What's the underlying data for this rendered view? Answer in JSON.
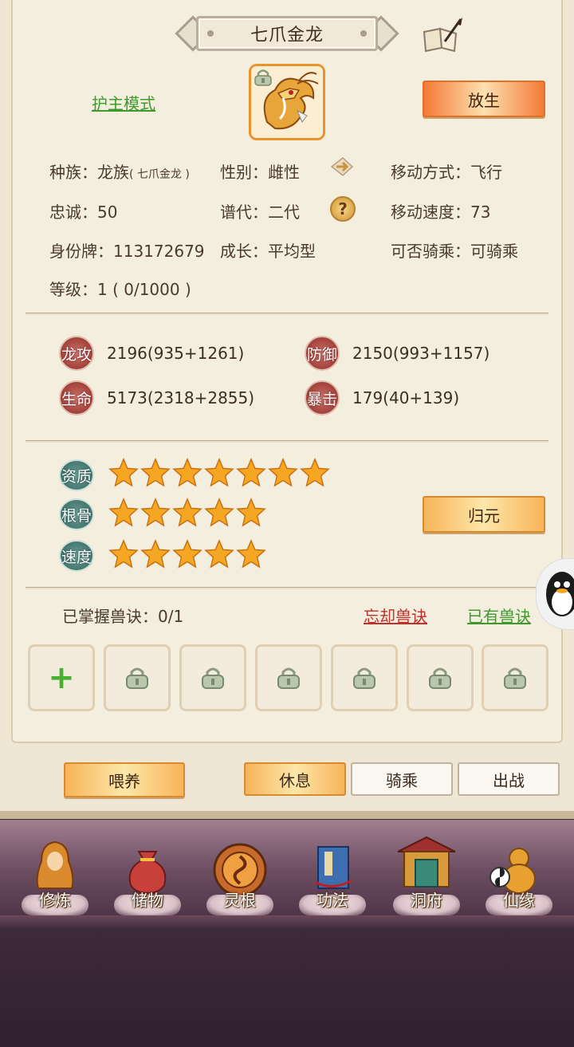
{
  "title": "七爪金龙",
  "top": {
    "guard_mode_link": "护主模式",
    "release_button": "放生"
  },
  "info": {
    "race_label": "种族：",
    "race_value": "龙族",
    "race_sub": "( 七爪金龙 )",
    "gender_label": "性别：",
    "gender_value": "雌性",
    "move_label": "移动方式：",
    "move_value": "飞行",
    "loyalty_label": "忠诚：",
    "loyalty_value": "50",
    "generation_label": "谱代：",
    "generation_value": "二代",
    "speed_label": "移动速度：",
    "speed_value": "73",
    "id_label": "身份牌：",
    "id_value": "113172679",
    "growth_label": "成长：",
    "growth_value": "平均型",
    "ride_label": "可否骑乘：",
    "ride_value": "可骑乘",
    "level_label": "等级：",
    "level_value": "1 ( 0/1000 )"
  },
  "stats": [
    {
      "label": "龙攻",
      "value": "2196(935+1261)"
    },
    {
      "label": "防御",
      "value": "2150(993+1157)"
    },
    {
      "label": "生命",
      "value": "5173(2318+2855)"
    },
    {
      "label": "暴击",
      "value": "179(40+139)"
    }
  ],
  "aptitude": [
    {
      "label": "资质",
      "stars": 7
    },
    {
      "label": "根骨",
      "stars": 5
    },
    {
      "label": "速度",
      "stars": 5
    }
  ],
  "return_button": "归元",
  "skills": {
    "mastered_label": "已掌握兽诀：",
    "mastered_value": "0/1",
    "forget_link": "忘却兽诀",
    "owned_link": "已有兽诀",
    "add_symbol": "+"
  },
  "actions": {
    "feed": "喂养",
    "rest": "休息",
    "ride": "骑乘",
    "battle": "出战"
  },
  "nav": [
    "修炼",
    "储物",
    "灵根",
    "功法",
    "洞府",
    "仙缘"
  ],
  "colors": {
    "accent_gold": "#f7b45a",
    "link_green": "#3e9a2b",
    "link_red": "#c03028",
    "star": "#f5a623"
  }
}
